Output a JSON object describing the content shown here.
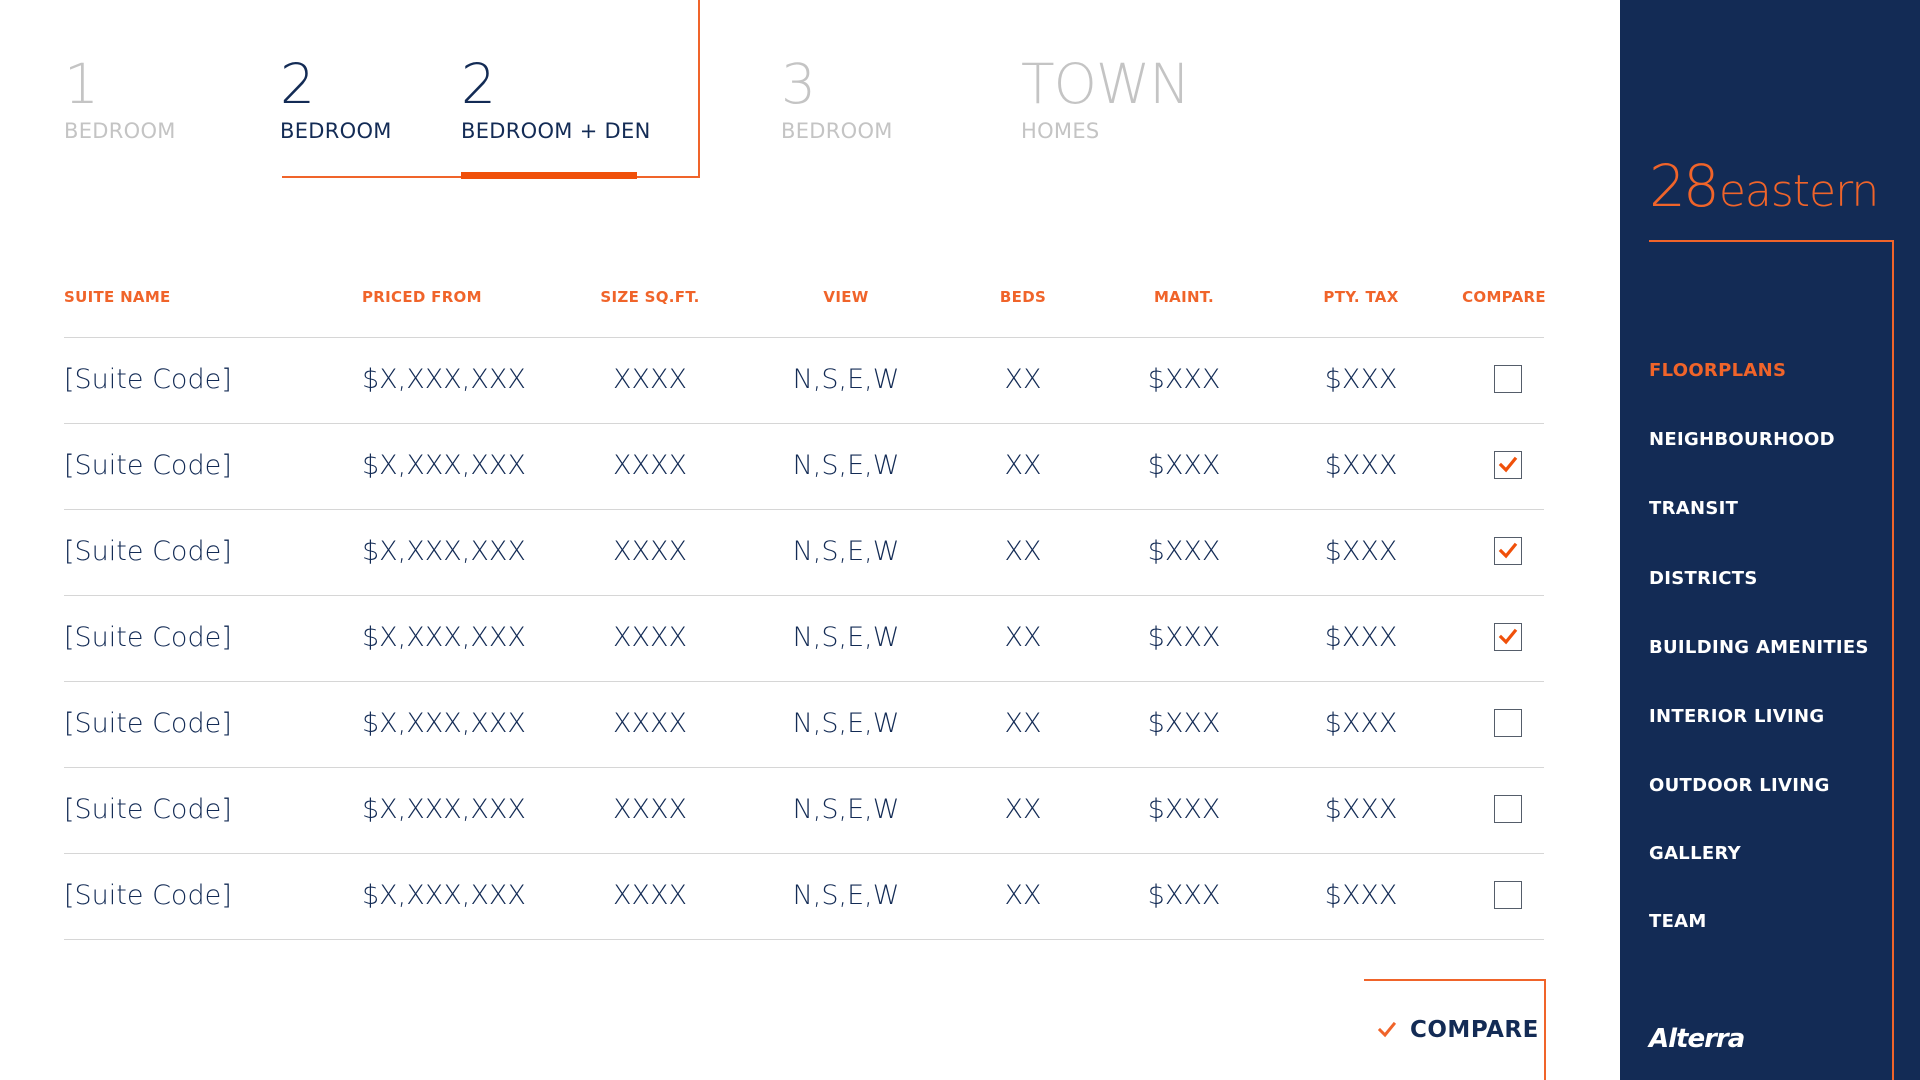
{
  "tabs": [
    {
      "number": "1",
      "label": "BEDROOM",
      "active": false
    },
    {
      "number": "2",
      "label": "BEDROOM",
      "active": true
    },
    {
      "number": "2",
      "label": "BEDROOM + DEN",
      "active": true
    },
    {
      "number": "3",
      "label": "BEDROOM",
      "active": false
    },
    {
      "number": "TOWN",
      "label": "HOMES",
      "active": false
    }
  ],
  "table": {
    "headers": [
      "SUITE NAME",
      "PRICED FROM",
      "SIZE SQ.FT.",
      "VIEW",
      "BEDS",
      "MAINT.",
      "PTY. TAX",
      "COMPARE"
    ],
    "rows": [
      {
        "suite": "[Suite Code]",
        "price": "$X,XXX,XXX",
        "size": "XXXX",
        "view": "N,S,E,W",
        "beds": "XX",
        "maint": "$XXX",
        "tax": "$XXX",
        "compare": false
      },
      {
        "suite": "[Suite Code]",
        "price": "$X,XXX,XXX",
        "size": "XXXX",
        "view": "N,S,E,W",
        "beds": "XX",
        "maint": "$XXX",
        "tax": "$XXX",
        "compare": true
      },
      {
        "suite": "[Suite Code]",
        "price": "$X,XXX,XXX",
        "size": "XXXX",
        "view": "N,S,E,W",
        "beds": "XX",
        "maint": "$XXX",
        "tax": "$XXX",
        "compare": true
      },
      {
        "suite": "[Suite Code]",
        "price": "$X,XXX,XXX",
        "size": "XXXX",
        "view": "N,S,E,W",
        "beds": "XX",
        "maint": "$XXX",
        "tax": "$XXX",
        "compare": true
      },
      {
        "suite": "[Suite Code]",
        "price": "$X,XXX,XXX",
        "size": "XXXX",
        "view": "N,S,E,W",
        "beds": "XX",
        "maint": "$XXX",
        "tax": "$XXX",
        "compare": false
      },
      {
        "suite": "[Suite Code]",
        "price": "$X,XXX,XXX",
        "size": "XXXX",
        "view": "N,S,E,W",
        "beds": "XX",
        "maint": "$XXX",
        "tax": "$XXX",
        "compare": false
      },
      {
        "suite": "[Suite Code]",
        "price": "$X,XXX,XXX",
        "size": "XXXX",
        "view": "N,S,E,W",
        "beds": "XX",
        "maint": "$XXX",
        "tax": "$XXX",
        "compare": false
      }
    ]
  },
  "compare_button": {
    "label": "COMPARE",
    "icon": "check-icon"
  },
  "sidebar": {
    "brand_number": "28",
    "brand_word": "eastern",
    "nav": [
      {
        "label": "FLOORPLANS",
        "active": true
      },
      {
        "label": "NEIGHBOURHOOD",
        "active": false
      },
      {
        "label": "TRANSIT",
        "active": false
      },
      {
        "label": "DISTRICTS",
        "active": false
      },
      {
        "label": "BUILDING AMENITIES",
        "active": false
      },
      {
        "label": "INTERIOR LIVING",
        "active": false
      },
      {
        "label": "OUTDOOR LIVING",
        "active": false
      },
      {
        "label": "GALLERY",
        "active": false
      },
      {
        "label": "TEAM",
        "active": false
      }
    ],
    "footer_logo": "Alterra"
  },
  "colors": {
    "navy": "#132b55",
    "accent": "#f0642a",
    "muted": "#c4c4c4",
    "divider": "#d6d6d6"
  }
}
